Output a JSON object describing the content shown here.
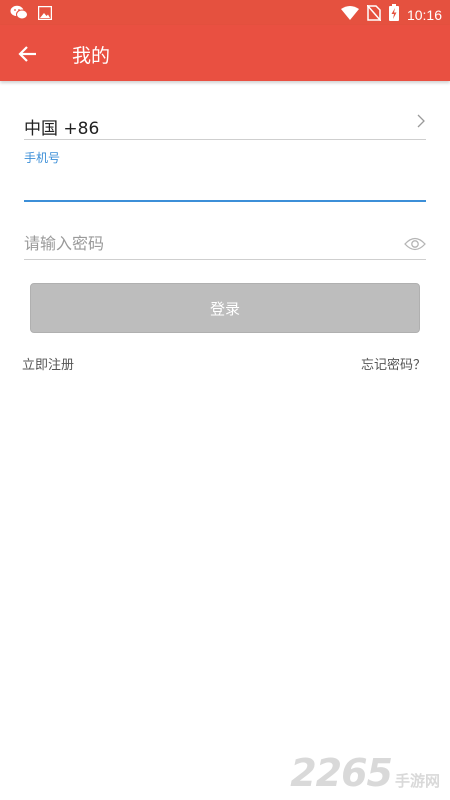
{
  "status_bar": {
    "time": "10:16",
    "left_icons": [
      "wechat-icon",
      "image-icon"
    ],
    "right_icons": [
      "wifi-icon",
      "no-sim-icon",
      "battery-charging-icon"
    ],
    "background": "#e5513f"
  },
  "toolbar": {
    "title": "我的",
    "back_icon": "arrow-left-icon",
    "background": "#e95041"
  },
  "form": {
    "country": "中国 +86",
    "phone_label": "手机号",
    "phone_value": "",
    "password_placeholder": "请输入密码",
    "login_label": "登录",
    "accent_color": "#3c8fd8"
  },
  "links": {
    "register": "立即注册",
    "forgot": "忘记密码？"
  },
  "watermark": {
    "number": "2265",
    "text": "手游网"
  }
}
